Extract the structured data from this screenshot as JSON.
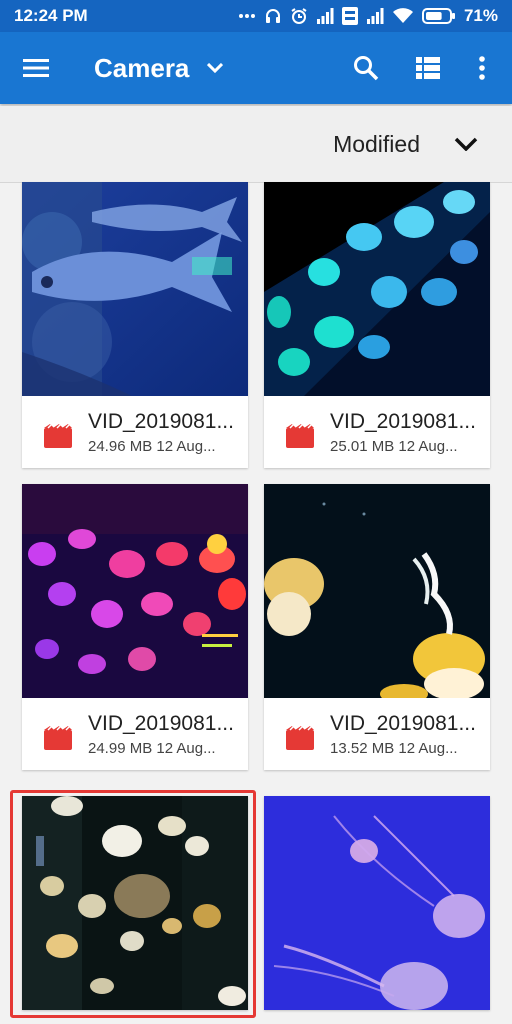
{
  "status_bar": {
    "time": "12:24 PM",
    "battery_percent": "71%",
    "battery_level": 0.71,
    "icons": [
      "dots-icon",
      "headphones-icon",
      "alarm-icon",
      "signal-icon",
      "volte-icon",
      "signal-icon",
      "wifi-icon",
      "battery-icon"
    ]
  },
  "app_bar": {
    "title": "Camera",
    "icons": [
      "menu-icon",
      "chevron-down-icon",
      "search-icon",
      "list-view-icon",
      "more-vert-icon"
    ]
  },
  "sort": {
    "label": "Modified"
  },
  "colors": {
    "status_bar": "#1565c0",
    "app_bar": "#1976d2",
    "video_icon": "#e53935",
    "selected_outline": "#e53935"
  },
  "files": [
    {
      "name": "VID_2019081...",
      "meta": "24.96 MB 12 Aug...",
      "thumbnail": "fish-aquarium",
      "type": "video"
    },
    {
      "name": "VID_2019081...",
      "meta": "25.01 MB 12 Aug...",
      "thumbnail": "cyan-jellyfish",
      "type": "video"
    },
    {
      "name": "VID_2019081...",
      "meta": "24.99 MB 12 Aug...",
      "thumbnail": "pink-jellyfish",
      "type": "video"
    },
    {
      "name": "VID_2019081...",
      "meta": "13.52 MB 12 Aug...",
      "thumbnail": "yellow-jellyfish",
      "type": "video"
    },
    {
      "name": "",
      "meta": "",
      "thumbnail": "white-jellyfish-tank",
      "type": "video",
      "selected": true
    },
    {
      "name": "",
      "meta": "",
      "thumbnail": "purple-jellyfish",
      "type": "video"
    }
  ]
}
